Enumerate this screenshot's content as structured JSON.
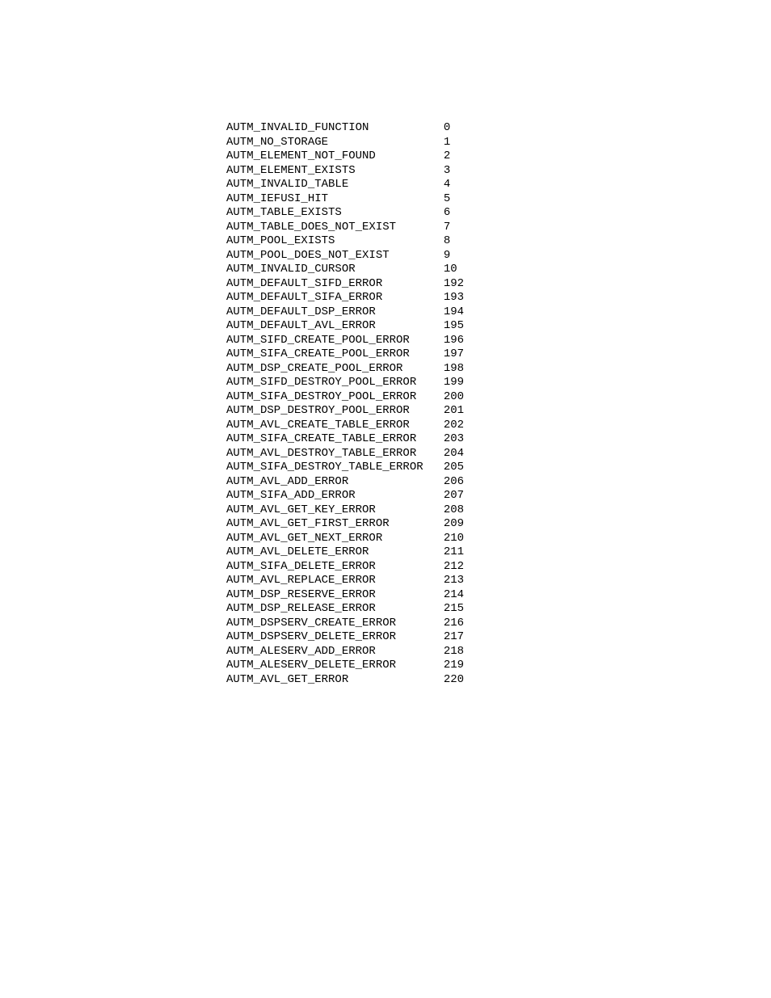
{
  "rows": [
    {
      "name": "AUTM_INVALID_FUNCTION",
      "value": "0"
    },
    {
      "name": "AUTM_NO_STORAGE",
      "value": "1"
    },
    {
      "name": "AUTM_ELEMENT_NOT_FOUND",
      "value": "2"
    },
    {
      "name": "AUTM_ELEMENT_EXISTS",
      "value": "3"
    },
    {
      "name": "AUTM_INVALID_TABLE",
      "value": "4"
    },
    {
      "name": "AUTM_IEFUSI_HIT",
      "value": "5"
    },
    {
      "name": "AUTM_TABLE_EXISTS",
      "value": "6"
    },
    {
      "name": "AUTM_TABLE_DOES_NOT_EXIST",
      "value": "7"
    },
    {
      "name": "AUTM_POOL_EXISTS",
      "value": "8"
    },
    {
      "name": "AUTM_POOL_DOES_NOT_EXIST",
      "value": "9"
    },
    {
      "name": "AUTM_INVALID_CURSOR",
      "value": "10"
    },
    {
      "name": "AUTM_DEFAULT_SIFD_ERROR",
      "value": "192"
    },
    {
      "name": "AUTM_DEFAULT_SIFA_ERROR",
      "value": "193"
    },
    {
      "name": "AUTM_DEFAULT_DSP_ERROR",
      "value": "194"
    },
    {
      "name": "AUTM_DEFAULT_AVL_ERROR",
      "value": "195"
    },
    {
      "name": "AUTM_SIFD_CREATE_POOL_ERROR",
      "value": "196"
    },
    {
      "name": "AUTM_SIFA_CREATE_POOL_ERROR",
      "value": "197"
    },
    {
      "name": "AUTM_DSP_CREATE_POOL_ERROR",
      "value": "198"
    },
    {
      "name": "AUTM_SIFD_DESTROY_POOL_ERROR",
      "value": "199"
    },
    {
      "name": "AUTM_SIFA_DESTROY_POOL_ERROR",
      "value": "200"
    },
    {
      "name": "AUTM_DSP_DESTROY_POOL_ERROR",
      "value": "201"
    },
    {
      "name": "AUTM_AVL_CREATE_TABLE_ERROR",
      "value": "202"
    },
    {
      "name": "AUTM_SIFA_CREATE_TABLE_ERROR",
      "value": "203"
    },
    {
      "name": "AUTM_AVL_DESTROY_TABLE_ERROR",
      "value": "204"
    },
    {
      "name": "AUTM_SIFA_DESTROY_TABLE_ERROR",
      "value": "205"
    },
    {
      "name": "AUTM_AVL_ADD_ERROR",
      "value": "206"
    },
    {
      "name": "AUTM_SIFA_ADD_ERROR",
      "value": "207"
    },
    {
      "name": "AUTM_AVL_GET_KEY_ERROR",
      "value": "208"
    },
    {
      "name": "AUTM_AVL_GET_FIRST_ERROR",
      "value": "209"
    },
    {
      "name": "AUTM_AVL_GET_NEXT_ERROR",
      "value": "210"
    },
    {
      "name": "AUTM_AVL_DELETE_ERROR",
      "value": "211"
    },
    {
      "name": "AUTM_SIFA_DELETE_ERROR",
      "value": "212"
    },
    {
      "name": "AUTM_AVL_REPLACE_ERROR",
      "value": "213"
    },
    {
      "name": "AUTM_DSP_RESERVE_ERROR",
      "value": "214"
    },
    {
      "name": "AUTM_DSP_RELEASE_ERROR",
      "value": "215"
    },
    {
      "name": "AUTM_DSPSERV_CREATE_ERROR",
      "value": "216"
    },
    {
      "name": "AUTM_DSPSERV_DELETE_ERROR",
      "value": "217"
    },
    {
      "name": "AUTM_ALESERV_ADD_ERROR",
      "value": "218"
    },
    {
      "name": "AUTM_ALESERV_DELETE_ERROR",
      "value": "219"
    },
    {
      "name": "AUTM_AVL_GET_ERROR",
      "value": "220"
    }
  ]
}
